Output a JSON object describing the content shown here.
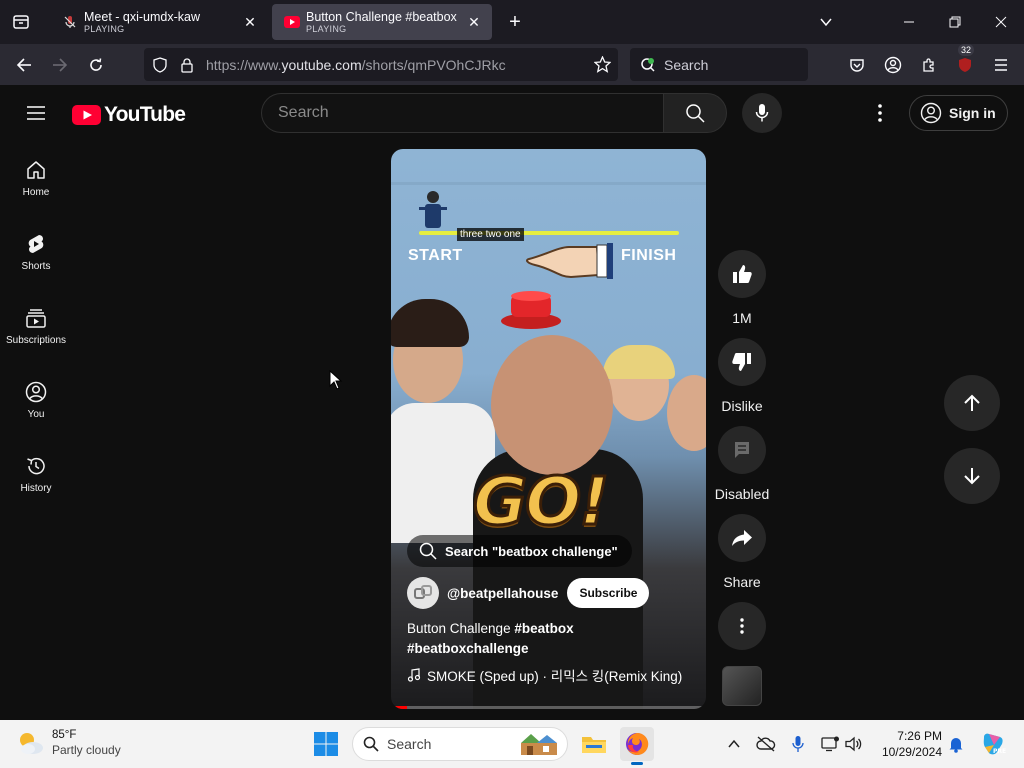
{
  "browser": {
    "tabs": [
      {
        "title": "Meet - qxi-umdx-kaw",
        "status": "PLAYING",
        "active": false
      },
      {
        "title": "Button Challenge #beatbox #be",
        "status": "PLAYING",
        "active": true
      }
    ],
    "url": {
      "prefix": "https://www.",
      "domain": "youtube.com",
      "path": "/shorts/qmPVOhCJRkc"
    },
    "search_placeholder": "Search",
    "extensions_badge": "32"
  },
  "youtube": {
    "logo_text": "YouTube",
    "search_placeholder": "Search",
    "sign_in_label": "Sign in",
    "sidebar": [
      {
        "label": "Home",
        "icon": "home-icon"
      },
      {
        "label": "Shorts",
        "icon": "shorts-icon"
      },
      {
        "label": "Subscriptions",
        "icon": "subscriptions-icon"
      },
      {
        "label": "You",
        "icon": "you-icon"
      },
      {
        "label": "History",
        "icon": "history-icon"
      }
    ],
    "short": {
      "caption_overlay": "three two one",
      "start_label": "START",
      "finish_label": "FINISH",
      "go_text": "GO!",
      "search_suggestion": "Search \"beatbox challenge\"",
      "channel": "@beatpellahouse",
      "subscribe_label": "Subscribe",
      "description_plain": "Button Challenge ",
      "hashtag1": "#beatbox",
      "hashtag2": "#beatboxchallenge",
      "music": "SMOKE (Sped up) · 리믹스 킹(Remix King)",
      "progress": 0.05
    },
    "actions": {
      "like_count": "1M",
      "dislike_label": "Dislike",
      "comments_label": "Disabled",
      "share_label": "Share"
    }
  },
  "taskbar": {
    "weather_temp": "85°F",
    "weather_condition": "Partly cloudy",
    "search_label": "Search",
    "time": "7:26 PM",
    "date": "10/29/2024"
  }
}
